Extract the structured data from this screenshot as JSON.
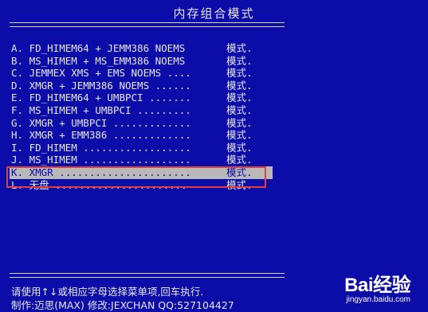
{
  "title": "内存组合模式",
  "menu_items": [
    {
      "label": "A. FD_HIMEM64 + JEMM386 NOEMS",
      "suffix": "模式."
    },
    {
      "label": "B. MS_HIMEM + MS_EMM386 NOEMS",
      "suffix": "模式."
    },
    {
      "label": "C. JEMMEX XMS + EMS NOEMS ....",
      "suffix": "模式."
    },
    {
      "label": "D. XMGR + JEMM386 NOEMS ......",
      "suffix": "模式."
    },
    {
      "label": "E. FD_HIMEM64 + UMBPCI .......",
      "suffix": "模式."
    },
    {
      "label": "F. MS_HIMEM + UMBPCI .........",
      "suffix": "模式."
    },
    {
      "label": "G. XMGR + UMBPCI .............",
      "suffix": "模式."
    },
    {
      "label": "H. XMGR + EMM386 .............",
      "suffix": "模式."
    },
    {
      "label": "I. FD_HIMEM ..................",
      "suffix": "模式."
    },
    {
      "label": "J. MS_HIMEM ..................",
      "suffix": "模式."
    },
    {
      "label": "K. XMGR ......................",
      "suffix": "模式."
    },
    {
      "label": "L. 无盘 ......................",
      "suffix": "模式."
    }
  ],
  "selected_index": 10,
  "footer": {
    "line1": "请使用↑↓或相应字母选择菜单项,回车执行.",
    "line2": "制作:迈思(MAX) 修改:JEXCHAN QQ:527104427"
  },
  "watermark": {
    "logo": "Bai经验",
    "url": "jingyan.baidu.com"
  },
  "colors": {
    "background": "#0c0ca8",
    "text": "#e6e6e6",
    "selection_bar": "#b9b9b9",
    "annotation_box": "#e0403c"
  }
}
